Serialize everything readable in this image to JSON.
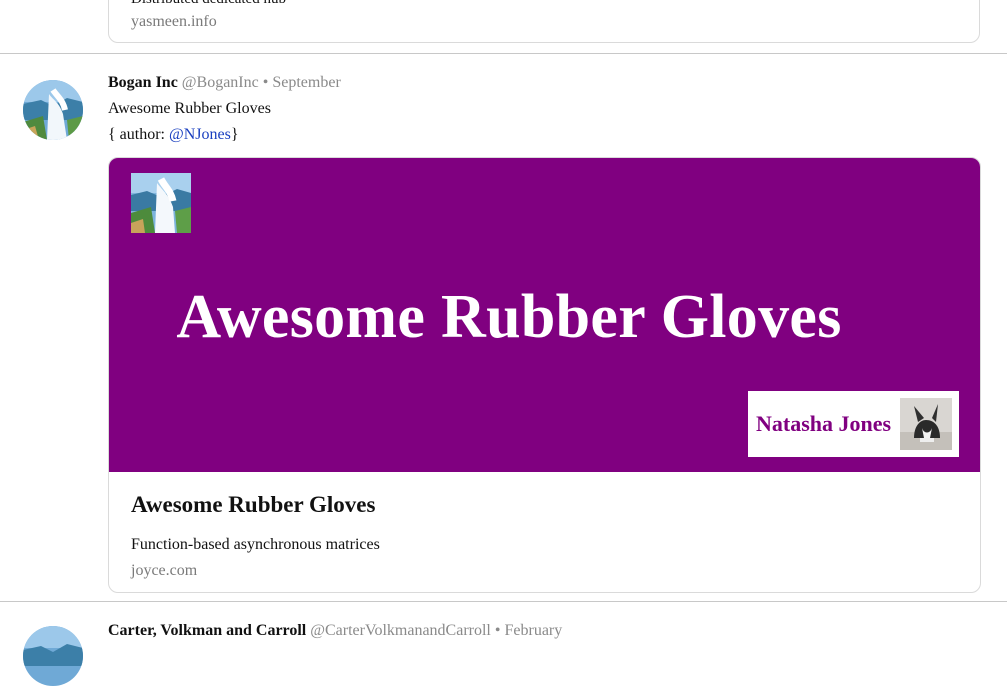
{
  "previous_post": {
    "clipped_text": "Distributed dedicated hub",
    "domain": "yasmeen.info"
  },
  "post": {
    "name": "Bogan Inc",
    "handle": "@BoganInc",
    "separator": "•",
    "date": "September",
    "text": "Awesome Rubber Gloves",
    "author_prefix": "{ author: ",
    "author_mention": "@NJones",
    "author_suffix": "}",
    "card": {
      "banner_color": "#800080",
      "banner_title": "Awesome Rubber Gloves",
      "author_name": "Natasha Jones",
      "title": "Awesome Rubber Gloves",
      "description": "Function-based asynchronous matrices",
      "domain": "joyce.com"
    }
  },
  "next_post": {
    "name": "Carter, Volkman and Carroll",
    "handle": "@CarterVolkmanandCarroll",
    "separator": "•",
    "date": "February"
  },
  "colors": {
    "accent_purple": "#800080",
    "mention_blue": "#1a3fbf",
    "muted_gray": "#8a8a8a"
  }
}
